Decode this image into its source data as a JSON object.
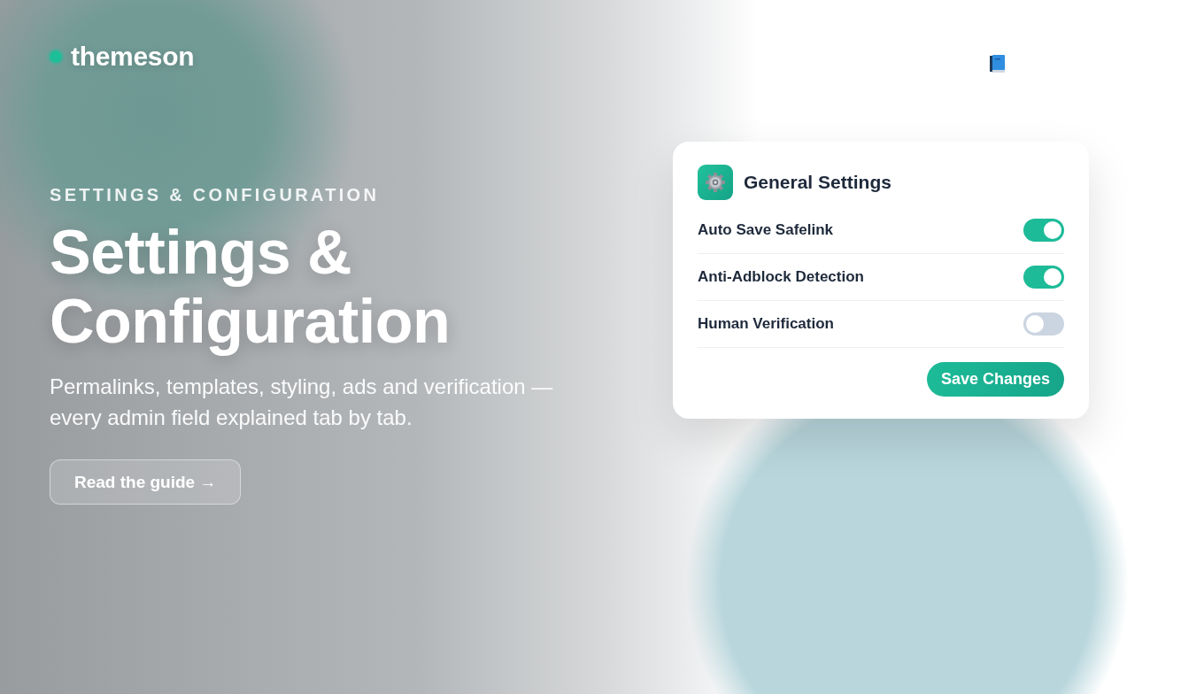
{
  "brand": {
    "name": "themeson"
  },
  "hero": {
    "eyebrow": "SETTINGS & CONFIGURATION",
    "title": "Settings & Configuration",
    "subtitle": "Permalinks, templates, styling, ads and verification — every admin field explained tab by tab.",
    "cta": "Read the guide →"
  },
  "card": {
    "title": "General Settings",
    "settings": [
      {
        "label": "Auto Save Safelink",
        "on": true
      },
      {
        "label": "Anti-Adblock Detection",
        "on": true
      },
      {
        "label": "Human Verification",
        "on": false
      }
    ],
    "button": "Save Changes"
  }
}
